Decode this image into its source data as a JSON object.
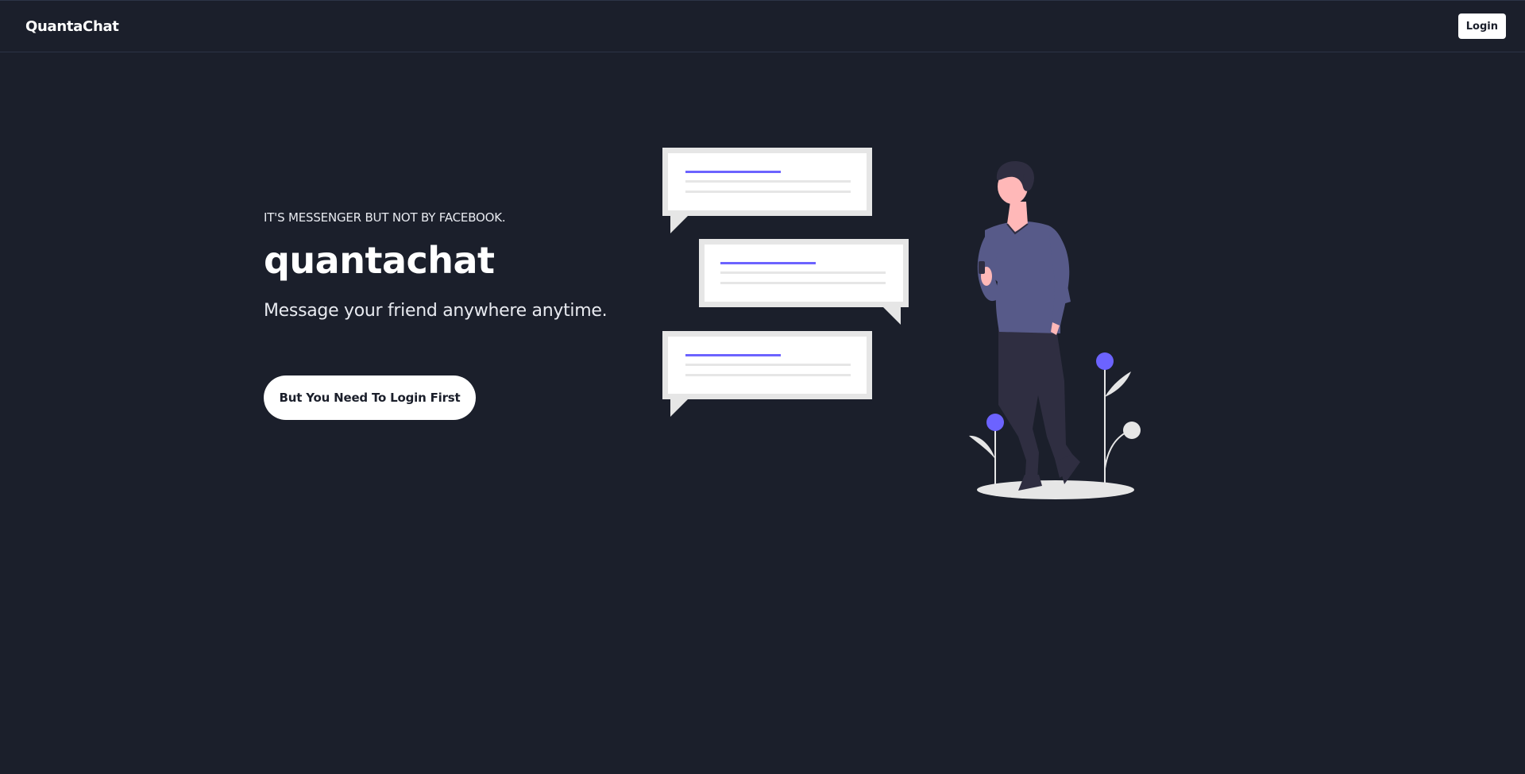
{
  "nav": {
    "brand": "QuantaChat",
    "login_label": "Login"
  },
  "hero": {
    "tagline": "IT'S MESSENGER BUT NOT BY FACEBOOK.",
    "title": "quantachat",
    "subtitle": "Message your friend anywhere anytime.",
    "cta_label": "But You Need To Login First"
  },
  "colors": {
    "background": "#1b1f2b",
    "accent": "#6c63ff",
    "bubble_frame": "#e6e6e6",
    "skin": "#ffb8b8",
    "shirt": "#575a89",
    "pants": "#2f2e41"
  },
  "icons": {
    "illustration": "man-texting-with-chat-bubbles-illustration"
  }
}
